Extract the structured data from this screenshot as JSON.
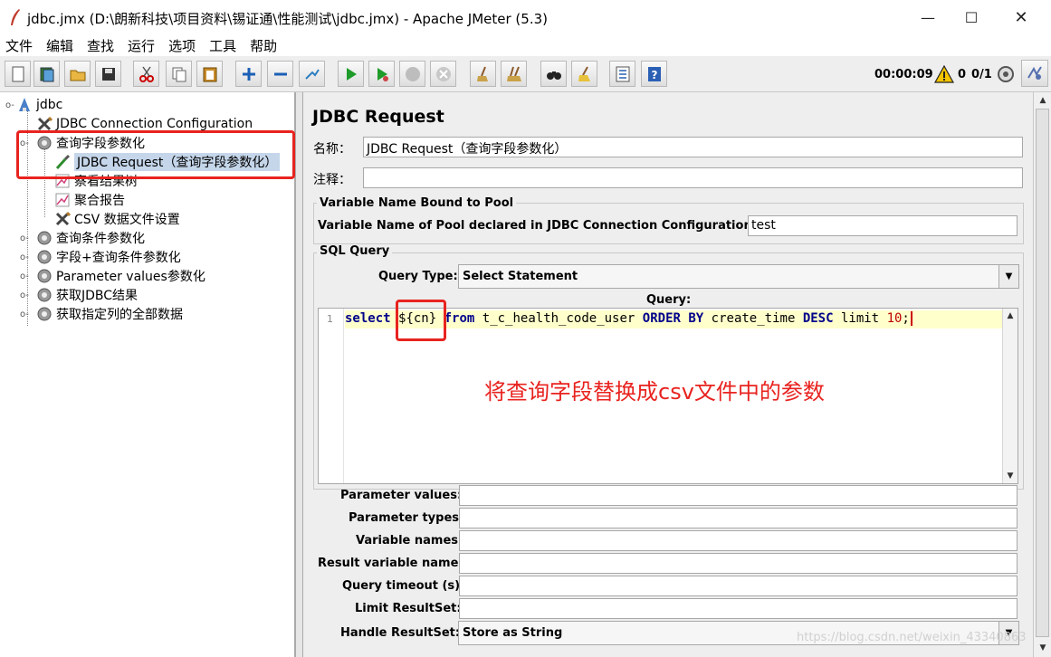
{
  "window": {
    "title": "jdbc.jmx (D:\\朗新科技\\项目资料\\锡证通\\性能测试\\jdbc.jmx) - Apache JMeter (5.3)",
    "minimize": "—",
    "maximize": "☐",
    "close": "✕"
  },
  "menu": [
    "文件",
    "编辑",
    "查找",
    "运行",
    "选项",
    "工具",
    "帮助"
  ],
  "toolbar": {
    "timer": "00:00:09",
    "error_count": "0",
    "thread_count": "0/1",
    "buttons": [
      "new-icon",
      "templates-icon",
      "open-icon",
      "save-icon",
      "cut-icon",
      "copy-icon",
      "paste-icon",
      "expand-icon",
      "collapse-icon",
      "toggle-icon",
      "start-icon",
      "start-no-pause-icon",
      "stop-icon",
      "shutdown-icon",
      "clear-icon",
      "clear-all-icon",
      "search-icon",
      "reset-search-icon",
      "function-helper-icon",
      "help-icon"
    ]
  },
  "tree": {
    "root": "jdbc",
    "items": [
      {
        "label": "JDBC Connection Configuration",
        "icon": "tools-icon"
      },
      {
        "label": "查询字段参数化",
        "icon": "gear-icon"
      },
      {
        "label": "JDBC Request（查询字段参数化）",
        "icon": "pipette-icon",
        "selected": true
      },
      {
        "label": "察看结果树",
        "icon": "chart-icon"
      },
      {
        "label": "聚合报告",
        "icon": "chart-icon"
      },
      {
        "label": "CSV 数据文件设置",
        "icon": "tools-icon"
      },
      {
        "label": "查询条件参数化",
        "icon": "gear-icon"
      },
      {
        "label": "字段+查询条件参数化",
        "icon": "gear-icon"
      },
      {
        "label": "Parameter values参数化",
        "icon": "gear-icon"
      },
      {
        "label": "获取JDBC结果",
        "icon": "gear-icon"
      },
      {
        "label": "获取指定列的全部数据",
        "icon": "gear-icon"
      }
    ]
  },
  "panel": {
    "heading": "JDBC Request",
    "name_label": "名称：",
    "name_value": "JDBC Request（查询字段参数化）",
    "comment_label": "注释：",
    "comment_value": "",
    "pool_group": "Variable Name Bound to Pool",
    "pool_label": "Variable Name of Pool declared in JDBC Connection Configuration:",
    "pool_value": "test",
    "sql_group": "SQL Query",
    "query_type_label": "Query Type:",
    "query_type_value": "Select Statement",
    "query_label": "Query:",
    "line_number": "1",
    "code": {
      "kw_select": "select",
      "var": "${cn}",
      "kw_from": "from",
      "table": "t_c_health_code_user",
      "kw_order": "ORDER BY",
      "column": "create_time",
      "kw_desc": "DESC",
      "limit": "limit",
      "number": "10",
      "semicolon": ";"
    },
    "fields": [
      {
        "label": "Parameter values:",
        "value": ""
      },
      {
        "label": "Parameter types:",
        "value": ""
      },
      {
        "label": "Variable names:",
        "value": ""
      },
      {
        "label": "Result variable name:",
        "value": ""
      },
      {
        "label": "Query timeout (s):",
        "value": ""
      },
      {
        "label": "Limit ResultSet:",
        "value": ""
      }
    ],
    "handle_label": "Handle ResultSet:",
    "handle_value": "Store as String"
  },
  "annotation": "将查询字段替换成csv文件中的参数",
  "watermark": "https://blog.csdn.net/weixin_43340863",
  "colors": {
    "highlight": "#e8231f",
    "selection": "#c5d6ea",
    "code_line": "#ffffcc",
    "keyword": "#00008b"
  }
}
